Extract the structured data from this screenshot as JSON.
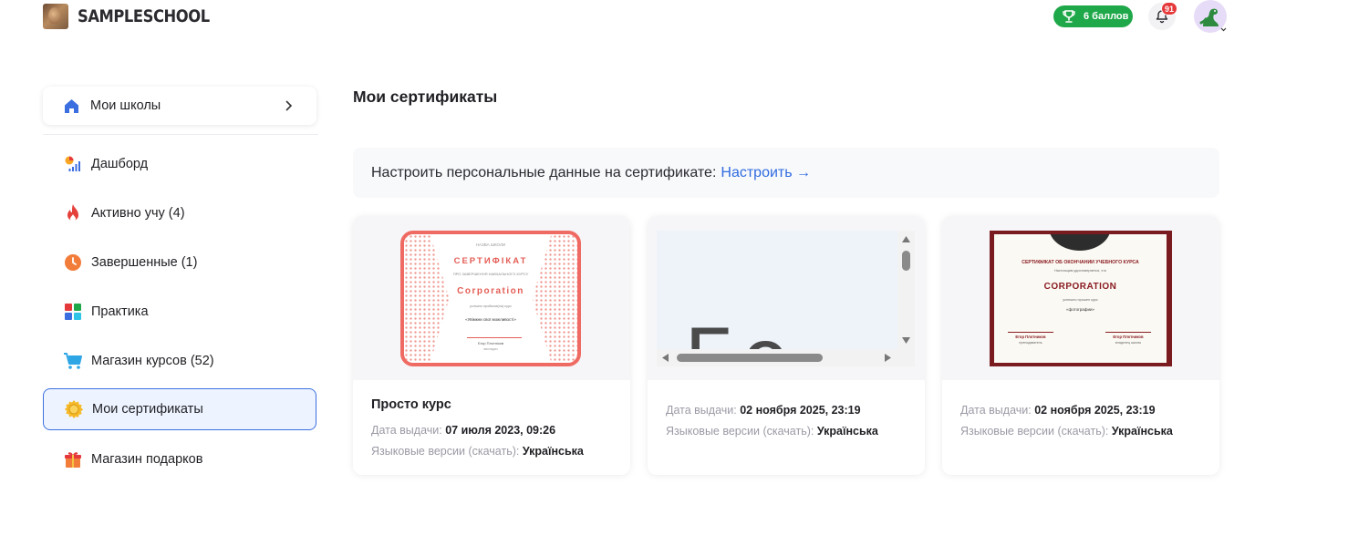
{
  "header": {
    "logo_text": "SAMPLESCHOOL",
    "points_label": "6 баллов",
    "notifications_count": "91"
  },
  "sidebar": {
    "schools_label": "Мои школы",
    "items": [
      {
        "label": "Дашборд",
        "icon": "dashboard-icon"
      },
      {
        "label": "Активно учу (4)",
        "icon": "fire-icon"
      },
      {
        "label": "Завершенные (1)",
        "icon": "clock-icon"
      },
      {
        "label": "Практика",
        "icon": "practice-grid-icon"
      },
      {
        "label": "Магазин курсов (52)",
        "icon": "cart-icon"
      },
      {
        "label": "Мои сертификаты",
        "icon": "certificate-badge-icon",
        "active": true
      },
      {
        "label": "Магазин подарков",
        "icon": "gift-icon"
      }
    ]
  },
  "main": {
    "title": "Мои сертификаты",
    "banner": {
      "text": "Настроить персональные данные на сертификате:",
      "link": "Настроить →"
    },
    "labels": {
      "issue_date": "Дата выдачи:",
      "languages": "Языковые версии (скачать):"
    },
    "cards": [
      {
        "title": "Просто курс",
        "issue_date": "07 июля 2023, 09:26",
        "language": "Українська",
        "preview": {
          "top": "НАЗВА ШКОЛИ",
          "heading": "СЕРТИФІКАТ",
          "subheading": "ПРО ЗАВЕРШЕННЯ НАВЧАЛЬНОГО КУРСУ",
          "name": "Corporation",
          "line": "успішно пройшов(ла) курс",
          "course": "«Увімкни свої можливості»",
          "signer": "Єгор Плотніков",
          "role": "викладач"
        }
      },
      {
        "title": "",
        "issue_date": "02 ноября 2025, 23:19",
        "language": "Українська",
        "preview": {
          "big_text": "Бо"
        }
      },
      {
        "title": "",
        "issue_date": "02 ноября 2025, 23:19",
        "language": "Українська",
        "preview": {
          "heading": "СЕРТИФИКАТ ОБ ОКОНЧАНИИ УЧЕБНОГО КУРСА",
          "line1": "Настоящим удостоверяется, что",
          "name": "CORPORATION",
          "line2": "успешно прошел курс",
          "course": "«фотографии»",
          "signer1": "Егор Плотников",
          "role1": "преподаватель",
          "signer2": "Егор Плотников",
          "role2": "владелец школы"
        }
      }
    ]
  },
  "colors": {
    "accent_blue": "#2f6bdf",
    "points_green": "#1fa84a",
    "notification_red": "#e5383b",
    "cert1_red": "#ef6a62",
    "cert3_maroon": "#7a1b1f"
  }
}
